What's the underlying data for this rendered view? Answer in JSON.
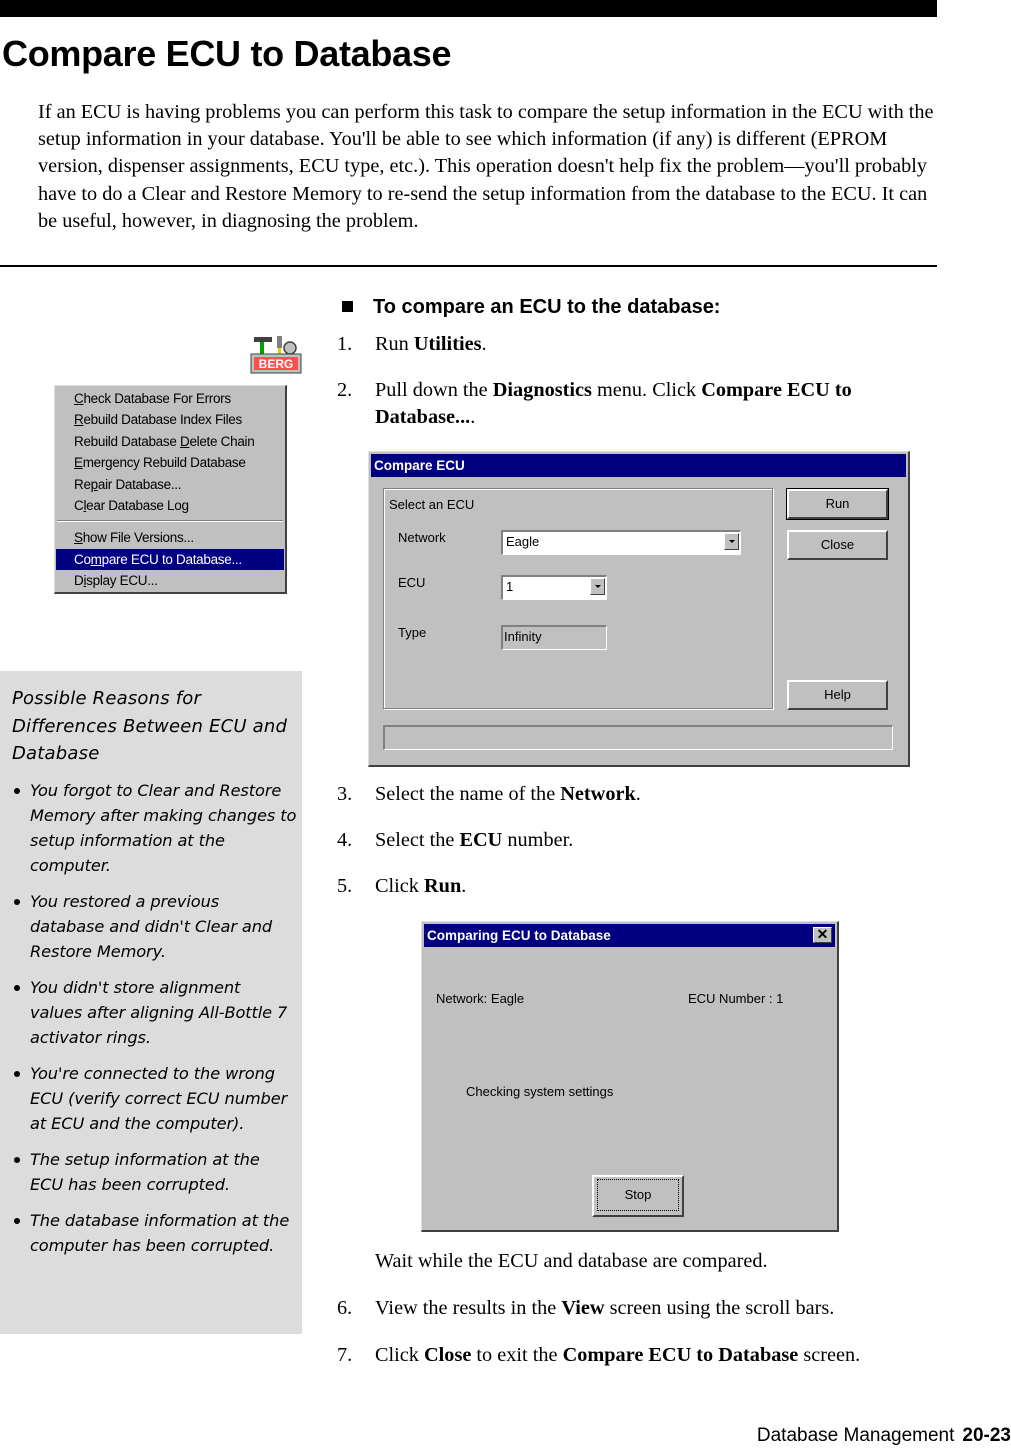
{
  "page": {
    "title": "Compare ECU to Database",
    "intro": "If an ECU is having problems you can perform this task to compare the setup information in the ECU with the setup information in your database. You'll be able to see which information (if any) is different (EPROM version, dispenser assignments, ECU type, etc.). This operation doesn't help fix the problem—you'll probably have to do a Clear and Restore Memory to re-send the setup information from the database to the ECU. It can be useful, however, in diagnosing the problem."
  },
  "icons": {
    "berg_label": "BERG"
  },
  "diagnostics_menu": {
    "items": [
      {
        "pre": "",
        "key": "C",
        "post": "heck Database For Errors"
      },
      {
        "pre": "",
        "key": "R",
        "post": "ebuild Database Index Files"
      },
      {
        "pre": "Rebuild Database ",
        "key": "D",
        "post": "elete Chain"
      },
      {
        "pre": "",
        "key": "E",
        "post": "mergency Rebuild Database"
      },
      {
        "pre": "Re",
        "key": "p",
        "post": "air Database..."
      },
      {
        "pre": "C",
        "key": "l",
        "post": "ear Database Log"
      },
      {
        "pre": "",
        "key": "S",
        "post": "how File Versions..."
      },
      {
        "pre": "Co",
        "key": "m",
        "post": "pare ECU to Database..."
      },
      {
        "pre": "D",
        "key": "i",
        "post": "splay ECU..."
      }
    ],
    "selected_index": 7
  },
  "sidebar": {
    "heading": "Possible Reasons for Differences Between ECU and Database",
    "reasons": [
      "You forgot to Clear and Restore Memory after making changes to setup information at the computer.",
      "You restored a previous database and didn't Clear and Restore Memory.",
      "You didn't store alignment values after aligning All-Bottle 7 activator rings.",
      "You're connected to the wrong ECU (verify correct ECU number at ECU and the computer).",
      "The setup information at the ECU has been corrupted.",
      "The database information at the computer has been corrupted."
    ]
  },
  "procedure": {
    "heading": "To compare an ECU to the database:",
    "steps": [
      {
        "num": "1.",
        "parts": [
          [
            "Run ",
            false
          ],
          [
            "Utilities",
            true
          ],
          [
            ".",
            false
          ]
        ]
      },
      {
        "num": "2.",
        "parts": [
          [
            "Pull down the ",
            false
          ],
          [
            "Diagnostics",
            true
          ],
          [
            " menu. Click ",
            false
          ],
          [
            "Compare ECU to Database...",
            true
          ],
          [
            ".",
            false
          ]
        ]
      },
      {
        "num": "3.",
        "parts": [
          [
            "Select the name of the ",
            false
          ],
          [
            "Network",
            true
          ],
          [
            ".",
            false
          ]
        ]
      },
      {
        "num": "4.",
        "parts": [
          [
            "Select the ",
            false
          ],
          [
            "ECU",
            true
          ],
          [
            " number.",
            false
          ]
        ]
      },
      {
        "num": "5.",
        "parts": [
          [
            "Click ",
            false
          ],
          [
            "Run",
            true
          ],
          [
            ".",
            false
          ]
        ]
      },
      {
        "num": "",
        "parts": [
          [
            "Wait while the ECU and database are compared.",
            false
          ]
        ]
      },
      {
        "num": "6.",
        "parts": [
          [
            "View the results in the ",
            false
          ],
          [
            "View",
            true
          ],
          [
            " screen using the scroll bars.",
            false
          ]
        ]
      },
      {
        "num": "7.",
        "parts": [
          [
            "Click ",
            false
          ],
          [
            "Close",
            true
          ],
          [
            " to exit the ",
            false
          ],
          [
            "Compare ECU to Database",
            true
          ],
          [
            " screen.",
            false
          ]
        ]
      }
    ]
  },
  "compare_dialog": {
    "title": "Compare ECU",
    "group_label": "Select an ECU",
    "network_label": "Network",
    "network_value": "Eagle",
    "ecu_label": "ECU",
    "ecu_value": "1",
    "type_label": "Type",
    "type_value": "Infinity",
    "run_label": "Run",
    "close_label": "Close",
    "help_label": "Help",
    "status_text": ""
  },
  "progress_dialog": {
    "title": "Comparing ECU to Database",
    "close_glyph": "✕",
    "network_text": "Network: Eagle",
    "ecu_number_text": "ECU Number : 1",
    "status_text": "Checking system settings",
    "stop_label": "Stop"
  },
  "footer": {
    "section": "Database Management",
    "page_number": "20-23"
  },
  "colors": {
    "titlebar": "#000080",
    "dialog_face": "#c0c0c0",
    "sidebar_bg": "#dcdcdc"
  }
}
